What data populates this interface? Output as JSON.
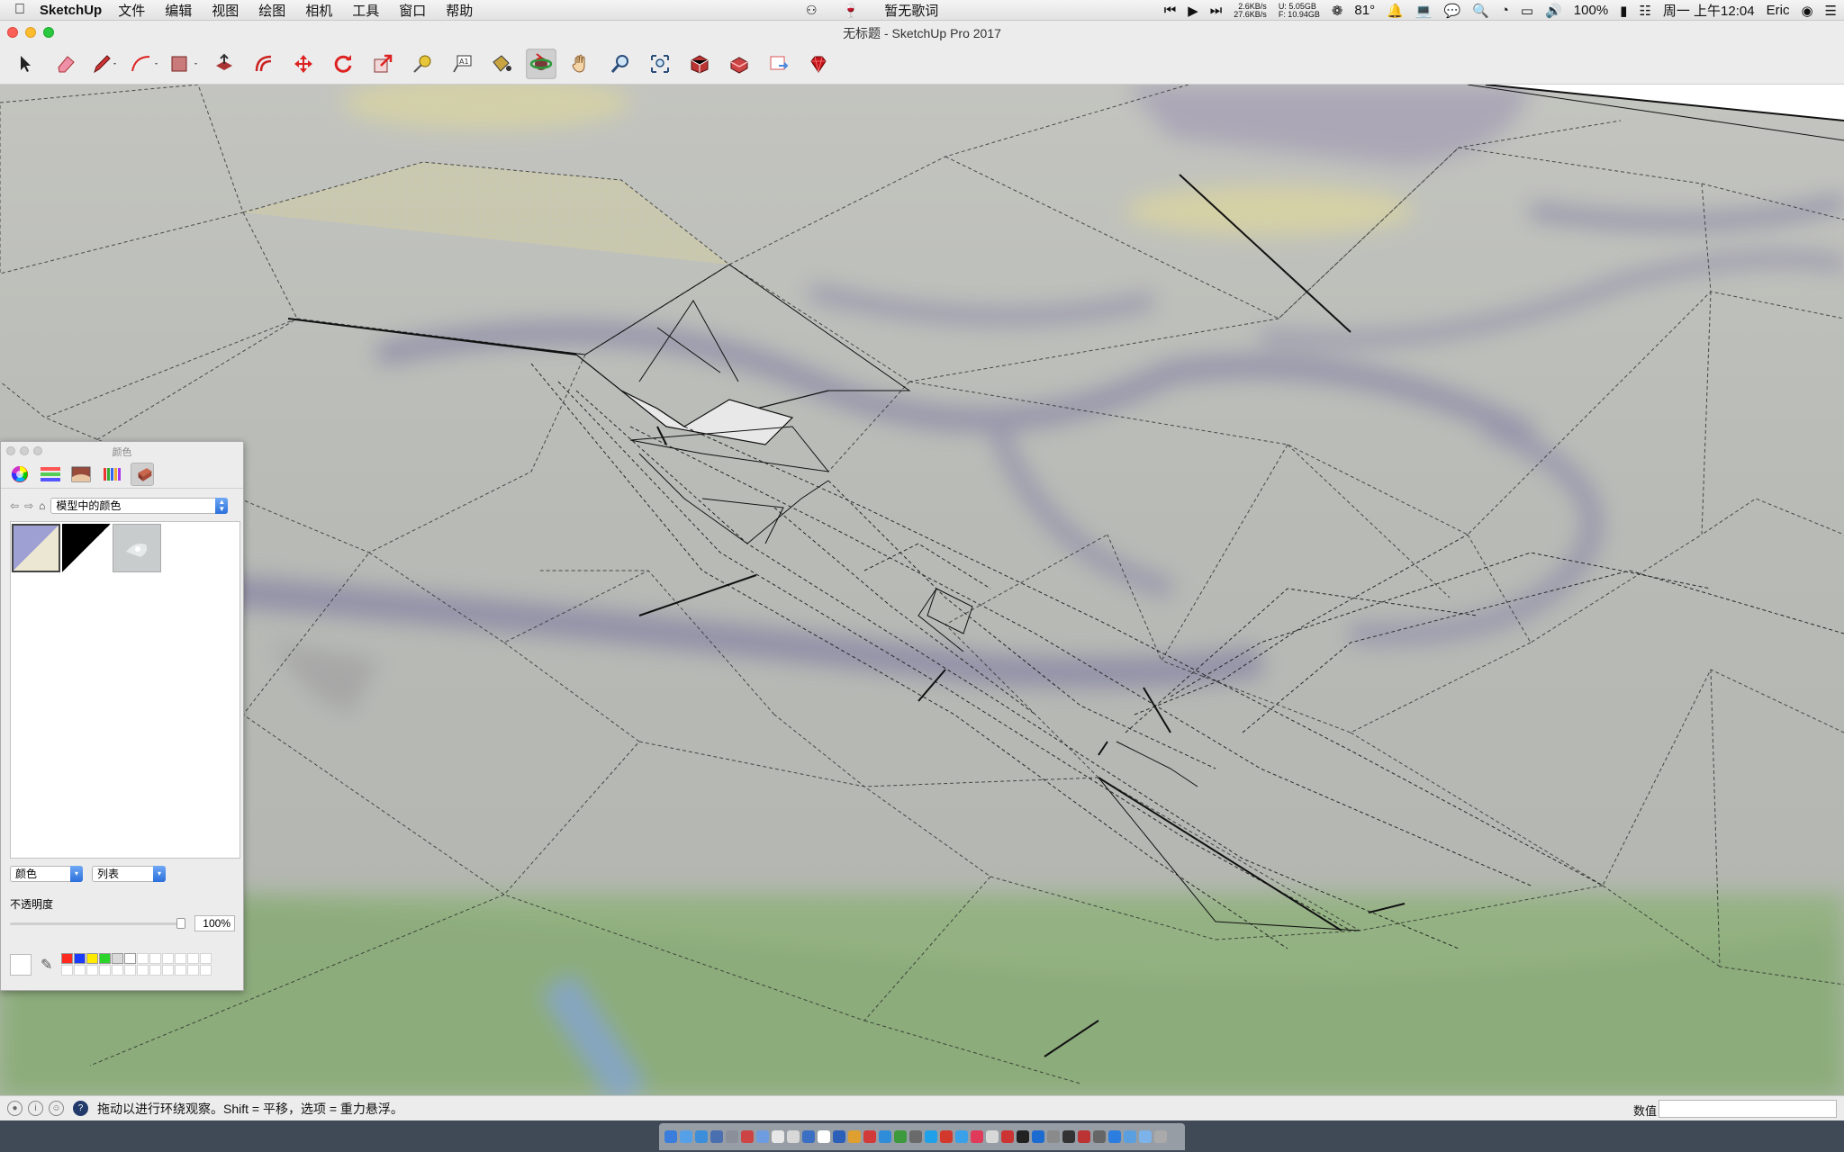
{
  "menubar": {
    "app_name": "SketchUp",
    "items": [
      "文件",
      "编辑",
      "视图",
      "绘图",
      "相机",
      "工具",
      "窗口",
      "帮助"
    ],
    "lyrics": "暂无歌词",
    "net_up": "2.6KB/s",
    "net_down": "27.6KB/s",
    "disk_u": "U: 5.05GB",
    "disk_f": "F: 10.94GB",
    "temperature": "81°",
    "battery": "100%",
    "clock": "周一 上午12:04",
    "user": "Eric"
  },
  "window": {
    "title": "无标题 - SketchUp Pro 2017"
  },
  "toolbar": {
    "tools": [
      {
        "name": "select-tool",
        "icon": "arrow-icon"
      },
      {
        "name": "eraser-tool",
        "icon": "eraser-icon"
      },
      {
        "name": "pencil-tool",
        "icon": "pencil-icon"
      },
      {
        "name": "arc-tool",
        "icon": "arc-icon"
      },
      {
        "name": "shape-tool",
        "icon": "rectangle-icon"
      },
      {
        "name": "push-pull-tool",
        "icon": "push-pull-icon"
      },
      {
        "name": "offset-tool",
        "icon": "offset-icon"
      },
      {
        "name": "move-tool",
        "icon": "move-icon"
      },
      {
        "name": "rotate-tool",
        "icon": "rotate-icon"
      },
      {
        "name": "scale-tool",
        "icon": "scale-icon"
      },
      {
        "name": "tape-measure-tool",
        "icon": "tape-measure-icon"
      },
      {
        "name": "text-tool",
        "icon": "text-icon"
      },
      {
        "name": "paint-bucket-tool",
        "icon": "paint-bucket-icon"
      },
      {
        "name": "orbit-tool",
        "icon": "orbit-icon",
        "active": true
      },
      {
        "name": "pan-tool",
        "icon": "hand-icon"
      },
      {
        "name": "zoom-tool",
        "icon": "magnifier-icon"
      },
      {
        "name": "zoom-extents-tool",
        "icon": "zoom-extents-icon"
      },
      {
        "name": "3d-warehouse-tool",
        "icon": "warehouse-icon"
      },
      {
        "name": "extension-warehouse-tool",
        "icon": "extension-icon"
      },
      {
        "name": "send-to-layout-tool",
        "icon": "layout-icon"
      },
      {
        "name": "ruby-console-tool",
        "icon": "ruby-icon"
      }
    ]
  },
  "colors_panel": {
    "title": "颜色",
    "collection": "模型中的颜色",
    "mode_select": "颜色",
    "view_select": "列表",
    "opacity_label": "不透明度",
    "opacity_value": "100%",
    "opacity": 1.0,
    "palette": [
      "#ff2a1f",
      "#1a3cff",
      "#ffea00",
      "#2bd42b",
      "#d9d9d9",
      "#ffffff"
    ]
  },
  "statusbar": {
    "message": "拖动以进行环绕观察。Shift = 平移，选项 = 重力悬浮。",
    "value_label": "数值",
    "value": ""
  }
}
